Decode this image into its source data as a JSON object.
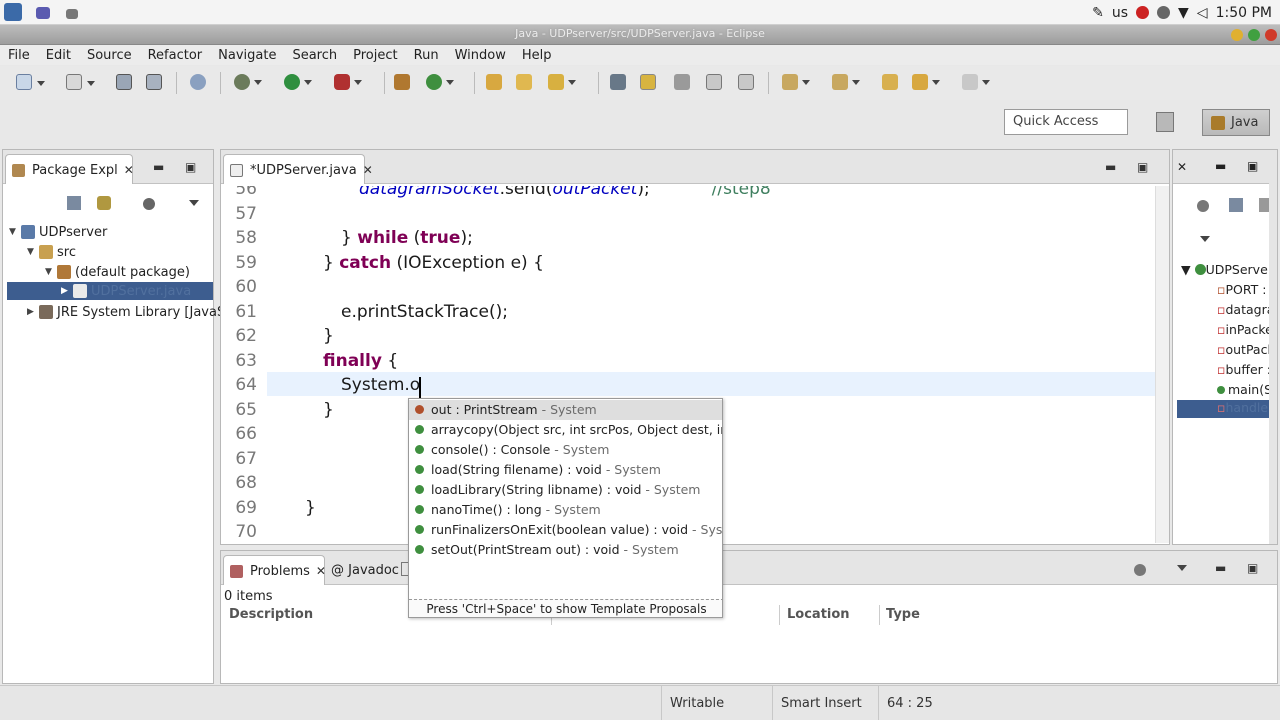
{
  "system": {
    "keyboard_layout": "us",
    "clock": "1:50 PM"
  },
  "window": {
    "title": "Java - UDPserver/src/UDPServer.java - Eclipse"
  },
  "menubar": [
    "File",
    "Edit",
    "Source",
    "Refactor",
    "Navigate",
    "Search",
    "Project",
    "Run",
    "Window",
    "Help"
  ],
  "toolbar": {
    "quick_access_placeholder": "Quick Access",
    "perspective_label": "Java"
  },
  "package_explorer": {
    "tab_label": "Package Expl",
    "tree": [
      {
        "label": "UDPserver",
        "arrow": "▼",
        "icon": "project-icon"
      },
      {
        "label": "src",
        "arrow": "▼",
        "icon": "source-folder-icon"
      },
      {
        "label": "(default package)",
        "arrow": "▼",
        "icon": "package-icon"
      },
      {
        "label": "UDPServer.java",
        "arrow": "▶",
        "icon": "java-file-icon"
      },
      {
        "label": "JRE System Library [JavaS",
        "arrow": "▶",
        "icon": "library-icon"
      }
    ]
  },
  "editor": {
    "tab_label": "*UDPServer.java",
    "line_numbers": [
      "56",
      "57",
      "58",
      "59",
      "60",
      "61",
      "62",
      "63",
      "64",
      "65",
      "66",
      "67",
      "68",
      "69",
      "70"
    ],
    "code": {
      "l56_a": "datagramSocket",
      "l56_b": ".send(",
      "l56_c": "outPacket",
      "l56_d": ");",
      "l56_comment": "//step8",
      "l58_a": "} ",
      "l58_kw1": "while",
      "l58_b": " (",
      "l58_kw2": "true",
      "l58_c": ");",
      "l59_a": "} ",
      "l59_kw": "catch",
      "l59_b": " (IOException e) {",
      "l61": "e.printStackTrace();",
      "l62": "}",
      "l63_kw": "finally",
      "l63_b": " {",
      "l64": "System.o",
      "l65": "}",
      "l69": "}"
    }
  },
  "content_assist": {
    "proposals": [
      {
        "name": "out : PrintStream",
        "origin": " - System"
      },
      {
        "name": "arraycopy(Object src, int srcPos, Object dest, int",
        "origin": ""
      },
      {
        "name": "console() : Console",
        "origin": " - System"
      },
      {
        "name": "load(String filename) : void",
        "origin": " - System"
      },
      {
        "name": "loadLibrary(String libname) : void",
        "origin": " - System"
      },
      {
        "name": "nanoTime() : long",
        "origin": " - System"
      },
      {
        "name": "runFinalizersOnExit(boolean value) : void",
        "origin": " - Syster"
      },
      {
        "name": "setOut(PrintStream out) : void",
        "origin": " - System"
      }
    ],
    "footer": "Press 'Ctrl+Space' to show Template Proposals"
  },
  "outline": {
    "items": [
      {
        "label": "UDPServe"
      },
      {
        "label": "PORT : i"
      },
      {
        "label": "datagra"
      },
      {
        "label": "inPacke"
      },
      {
        "label": "outPack"
      },
      {
        "label": "buffer :"
      },
      {
        "label": "main(S"
      },
      {
        "label": "handle"
      }
    ]
  },
  "problems": {
    "tab_label": "Problems",
    "javadoc_label": "Javadoc",
    "summary": "0 items",
    "columns": [
      "Description",
      "Location",
      "Type"
    ]
  },
  "statusbar": {
    "writable": "Writable",
    "insert_mode": "Smart Insert",
    "position": "64 : 25"
  },
  "colors": {
    "keyword": "#7f0055",
    "comment": "#3f7f5f",
    "field": "#0000c0",
    "selection": "#3d5d8f",
    "current_line": "#e8f2fe"
  }
}
